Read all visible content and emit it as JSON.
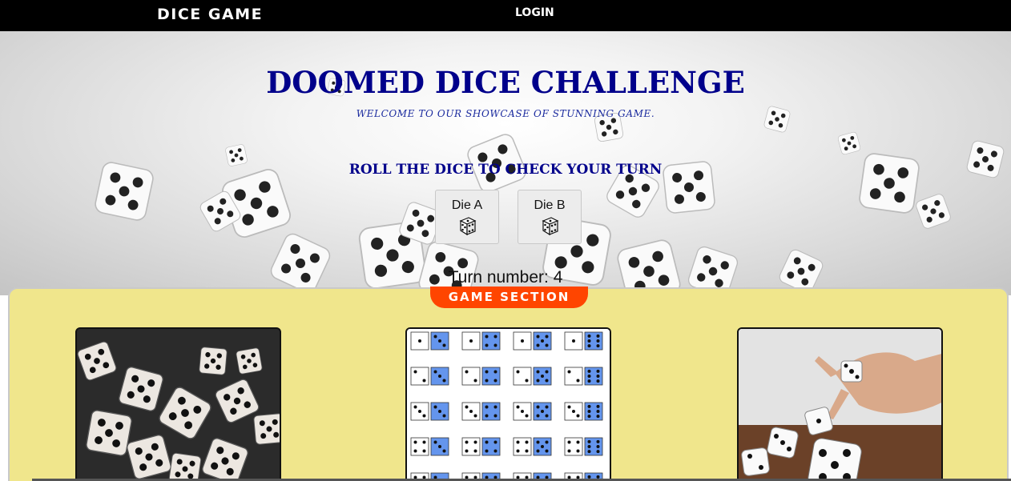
{
  "navbar": {
    "brand": "DICE GAME",
    "login": "LOGIN"
  },
  "hero": {
    "title": "DOOMED DICE CHALLENGE",
    "subtitle": "WELCOME TO OUR SHOWCASE OF STUNNING GAME.",
    "roll_heading": "ROLL THE DICE TO CHECK YOUR TURN",
    "die_a_label": "Die A",
    "die_b_label": "Die B",
    "turn_text": "Turn number: 4"
  },
  "game_section": {
    "badge": "GAME SECTION",
    "cards": [
      {
        "image": "dice-pile-photo"
      },
      {
        "image": "dice-sum-grid"
      },
      {
        "image": "hand-rolling-dice-photo"
      }
    ]
  },
  "colors": {
    "nav_bg": "#000000",
    "title_color": "#00008b",
    "badge_bg": "#ff4500",
    "section_bg": "#f0e68c",
    "grid_blue": "#6495ed"
  }
}
